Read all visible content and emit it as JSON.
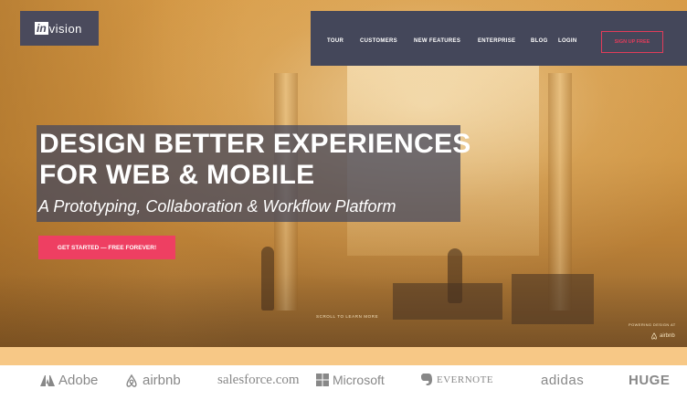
{
  "brand": {
    "logo_in": "in",
    "logo_rest": "vision"
  },
  "nav": {
    "items": [
      {
        "label": "TOUR"
      },
      {
        "label": "CUSTOMERS"
      },
      {
        "label": "NEW FEATURES"
      },
      {
        "label": "ENTERPRISE"
      },
      {
        "label": "BLOG"
      },
      {
        "label": "LOGIN"
      }
    ],
    "signup": "SIGN UP FREE"
  },
  "hero": {
    "headline_line1": "DESIGN BETTER EXPERIENCES",
    "headline_line2": "FOR WEB & MOBILE",
    "subline": "A Prototyping, Collaboration & Workflow Platform",
    "cta": "GET STARTED — FREE FOREVER!",
    "scroll_hint": "SCROLL TO LEARN MORE",
    "powered_by": "POWERING DESIGN AT",
    "powered_brand": "airbnb"
  },
  "clients": [
    {
      "name": "Adobe",
      "icon": "adobe-icon"
    },
    {
      "name": "airbnb",
      "icon": "airbnb-icon"
    },
    {
      "name": "salesforce.com",
      "icon": ""
    },
    {
      "name": "Microsoft",
      "icon": "microsoft-icon"
    },
    {
      "name": "EVERNOTE",
      "icon": "evernote-icon"
    },
    {
      "name": "adidas",
      "icon": ""
    },
    {
      "name": "HUGE",
      "icon": ""
    }
  ],
  "colors": {
    "accent": "#ee3f62",
    "nav_bg": "#44475a",
    "hero_tint": "#d79b47"
  }
}
